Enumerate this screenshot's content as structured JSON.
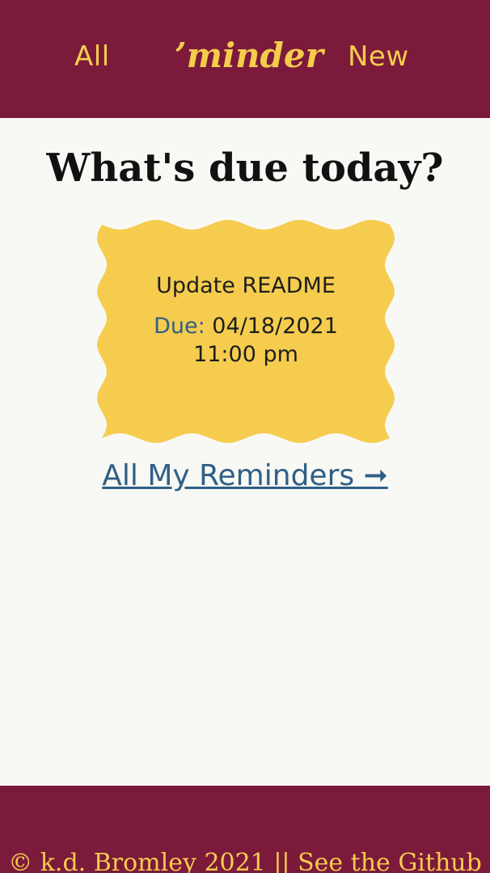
{
  "nav": {
    "all_label": "All",
    "logo": "’minder",
    "new_label": "New"
  },
  "main": {
    "title": "What's due today?",
    "reminder": {
      "title": "Update README",
      "due_label": "Due:",
      "due_date": "04/18/2021",
      "due_time": "11:00 pm"
    },
    "all_link_label": "All My Reminders ➞"
  },
  "footer": {
    "copyright": "© k.d. Bromley 2021 || ",
    "github_label": "See the Github"
  },
  "colors": {
    "header_bg": "#7c1a3b",
    "accent": "#f5cc4d",
    "link": "#2f5f86",
    "card_bg": "#f5cc4d",
    "page_bg": "#f8f8f5"
  }
}
